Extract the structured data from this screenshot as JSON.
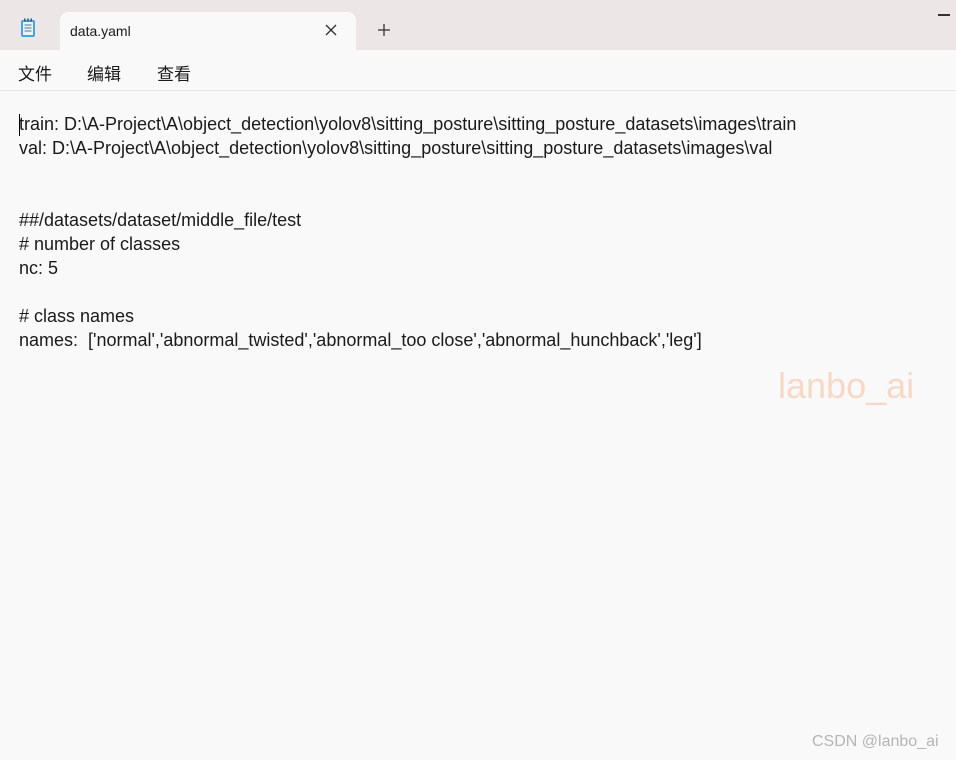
{
  "window": {
    "icon": "notepad-icon",
    "tab_title": "data.yaml",
    "close_icon": "close-icon",
    "new_tab_icon": "plus-icon",
    "minimize_icon": "minimize-icon"
  },
  "menu": {
    "file": "文件",
    "edit": "编辑",
    "view": "查看"
  },
  "editor": {
    "lines": [
      "train: D:\\A-Project\\A\\object_detection\\yolov8\\sitting_posture\\sitting_posture_datasets\\images\\train",
      "val: D:\\A-Project\\A\\object_detection\\yolov8\\sitting_posture\\sitting_posture_datasets\\images\\val",
      "",
      "",
      "##/datasets/dataset/middle_file/test",
      "# number of classes",
      "nc: 5",
      "",
      "# class names",
      "names:  ['normal','abnormal_twisted','abnormal_too close','abnormal_hunchback','leg']"
    ]
  },
  "watermark": "lanbo_ai",
  "footer_watermark": "CSDN @lanbo_ai"
}
